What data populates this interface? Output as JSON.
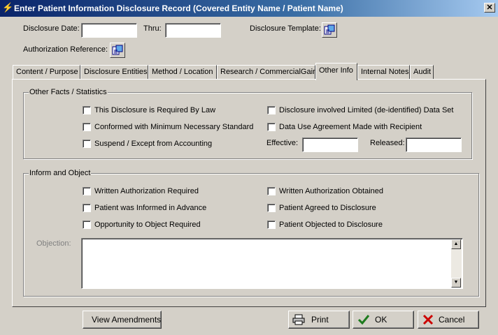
{
  "window": {
    "title": "Enter Patient Information Disclosure Record (Covered Entity Name / Patient Name)",
    "close_label": "✕"
  },
  "header": {
    "disclosure_date_label": "Disclosure Date:",
    "disclosure_date_value": "",
    "thru_label": "Thru:",
    "thru_value": "",
    "template_label": "Disclosure Template:",
    "authorization_label": "Authorization Reference:"
  },
  "tabs": [
    {
      "label": "Content / Purpose"
    },
    {
      "label": "Disclosure Entities"
    },
    {
      "label": "Method / Location"
    },
    {
      "label": "Research / CommercialGain"
    },
    {
      "label": "Other Info",
      "active": true
    },
    {
      "label": "Internal Notes"
    },
    {
      "label": "Audit"
    }
  ],
  "facts": {
    "title": "Other Facts / Statistics",
    "required_by_law": "This Disclosure is Required By Law",
    "minimum_necessary": "Conformed with Minimum Necessary Standard",
    "suspend_accounting": "Suspend / Except from Accounting",
    "limited_data_set": "Disclosure involved Limited (de-identified) Data Set",
    "data_use_agreement": "Data Use Agreement Made with Recipient",
    "effective_label": "Effective:",
    "effective_value": "",
    "released_label": "Released:",
    "released_value": ""
  },
  "inform": {
    "title": "Inform and Object",
    "written_auth_required": "Written Authorization Required",
    "informed_in_advance": "Patient was Informed in Advance",
    "opportunity_to_object": "Opportunity to Object Required",
    "written_auth_obtained": "Written Authorization Obtained",
    "agreed_to_disclosure": "Patient Agreed to Disclosure",
    "objected_to_disclosure": "Patient Objected to Disclosure",
    "objection_label": "Objection:",
    "objection_value": ""
  },
  "footer": {
    "view_amendments": "View Amendments",
    "print": "Print",
    "ok": "OK",
    "cancel": "Cancel"
  }
}
